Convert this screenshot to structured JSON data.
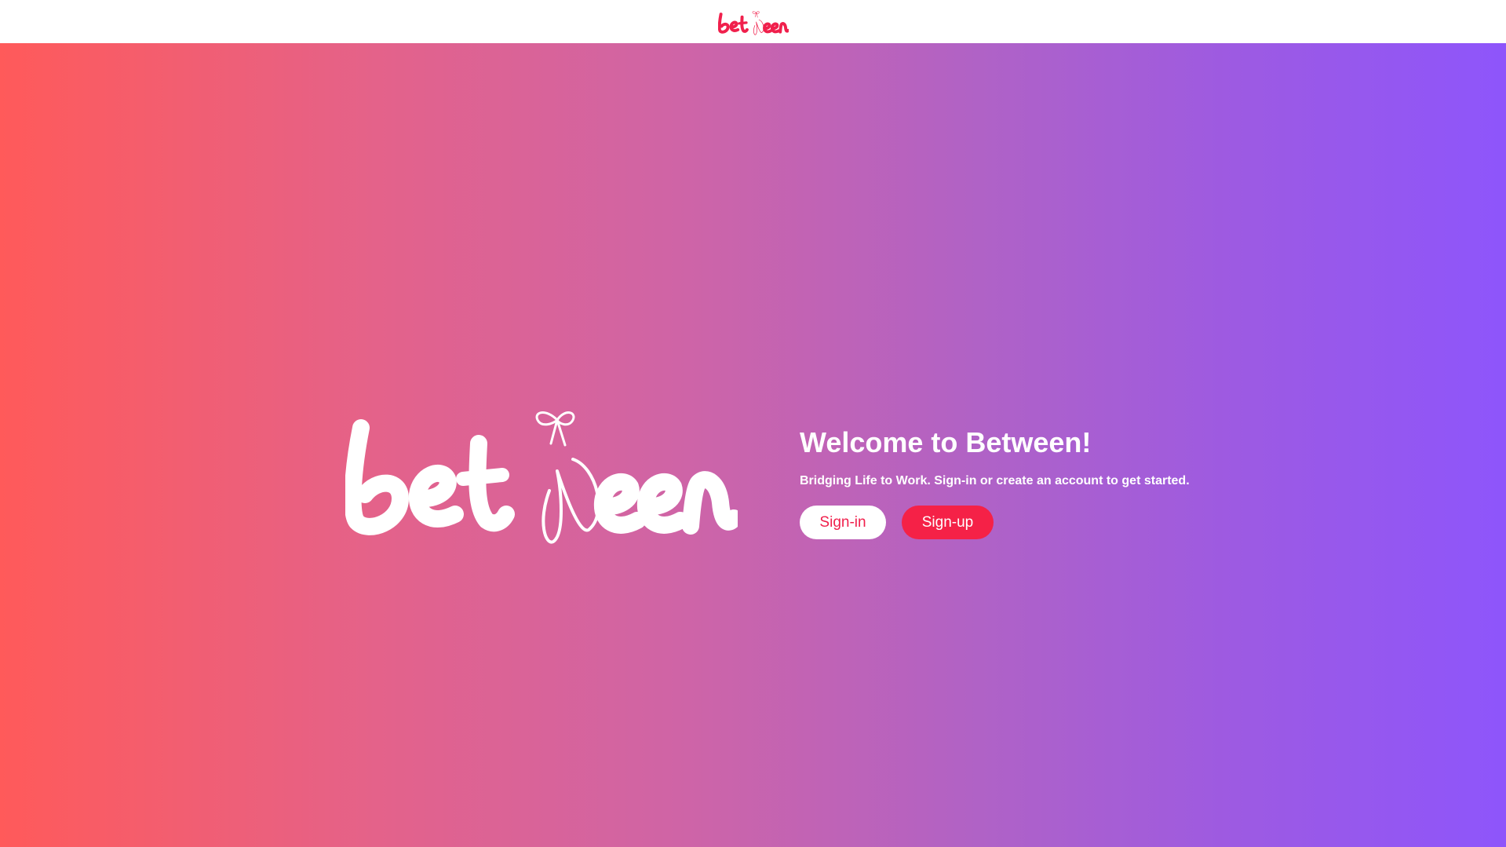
{
  "header": {
    "logo_icon": "between-logo-icon",
    "logo_color": "#f0204c"
  },
  "hero": {
    "logo_icon": "between-logo-icon",
    "background_gradient": [
      "#ff5a5a",
      "#8e55fb"
    ],
    "title": "Welcome to Between!",
    "subtitle": "Bridging Life to Work. Sign-in or create an account to get started.",
    "signin_label": "Sign-in",
    "signup_label": "Sign-up",
    "accent_color": "#f52147"
  }
}
